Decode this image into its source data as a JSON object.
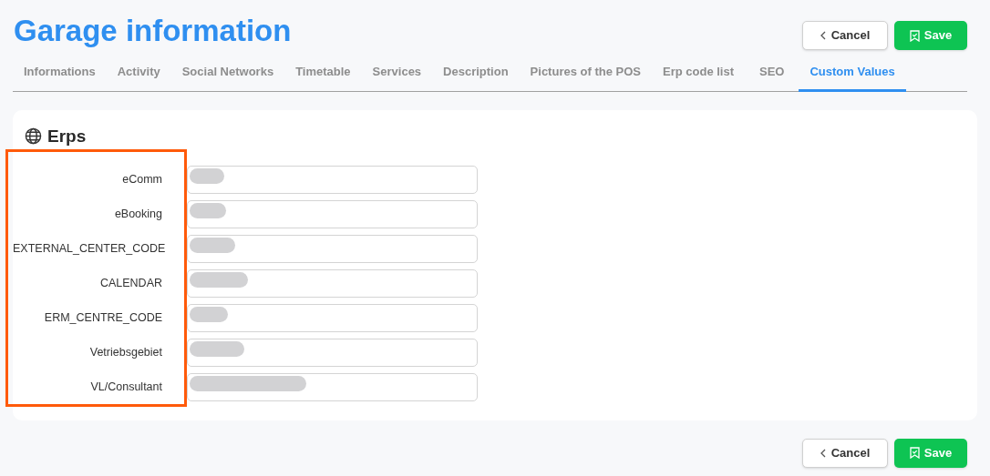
{
  "page": {
    "title": "Garage information"
  },
  "header_buttons": [
    {
      "kind": "cancel",
      "label": "Cancel"
    },
    {
      "kind": "save",
      "label": "Save"
    }
  ],
  "tabs": [
    {
      "label": "Informations",
      "selected": false
    },
    {
      "label": "Activity",
      "selected": false
    },
    {
      "label": "Social Networks",
      "selected": false
    },
    {
      "label": "Timetable",
      "selected": false
    },
    {
      "label": "Services",
      "selected": false
    },
    {
      "label": "Description",
      "selected": false
    },
    {
      "label": "Pictures of the POS",
      "selected": false
    },
    {
      "label": "Erp code list",
      "selected": false
    },
    {
      "label": "SEO",
      "selected": false
    },
    {
      "label": "Custom Values",
      "selected": true
    }
  ],
  "section": {
    "title": "Erps",
    "fields": [
      {
        "label": "eComm",
        "redacted": true
      },
      {
        "label": "eBooking",
        "redacted": true
      },
      {
        "label": "EXTERNAL_CENTER_CODE",
        "redacted": true
      },
      {
        "label": "CALENDAR",
        "redacted": true
      },
      {
        "label": "ERM_CENTRE_CODE",
        "redacted": true
      },
      {
        "label": "Vetriebsgebiet",
        "redacted": true
      },
      {
        "label": "VL/Consultant",
        "redacted": true
      }
    ]
  },
  "footer_buttons": [
    {
      "kind": "cancel",
      "label": "Cancel"
    },
    {
      "kind": "save",
      "label": "Save"
    }
  ]
}
